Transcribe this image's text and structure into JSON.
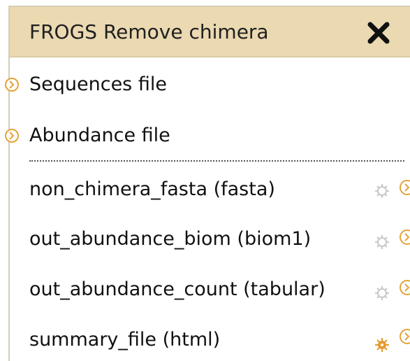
{
  "node": {
    "title": "FROGS Remove chimera",
    "close_icon": "close-icon",
    "inputs": [
      {
        "label": "Sequences file",
        "icon": "input-terminal-icon"
      },
      {
        "label": "Abundance file",
        "icon": "input-terminal-icon"
      }
    ],
    "outputs": [
      {
        "label": "non_chimera_fasta (fasta)",
        "icon": "gear-icon",
        "active": false
      },
      {
        "label": "out_abundance_biom (biom1)",
        "icon": "gear-icon",
        "active": false
      },
      {
        "label": "out_abundance_count (tabular)",
        "icon": "gear-icon",
        "active": false
      },
      {
        "label": "summary_file (html)",
        "icon": "gear-icon",
        "active": true
      }
    ]
  },
  "colors": {
    "header_bg": "#ebd9b2",
    "terminal": "#e5a23a",
    "gear_inactive": "#c8c8c8",
    "gear_active": "#e59a2e"
  }
}
